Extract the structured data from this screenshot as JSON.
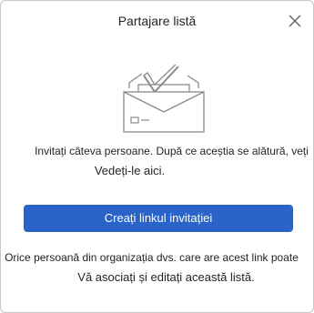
{
  "dialog": {
    "title": "Partajare listă",
    "close_icon": "close-icon",
    "illustration_icon": "envelope-checkmark-icon",
    "description_line1": "Invitați câteva persoane. După ce aceștia se alătură, veți",
    "description_line2": "Vedeți-le aici.",
    "primary_button_label": "Creați linkul invitației",
    "info_line1": "Orice persoană din organizația dvs. care are acest link poate",
    "info_line2": "Vă asociați și editați această listă.",
    "accent_color": "#2a64c8"
  }
}
